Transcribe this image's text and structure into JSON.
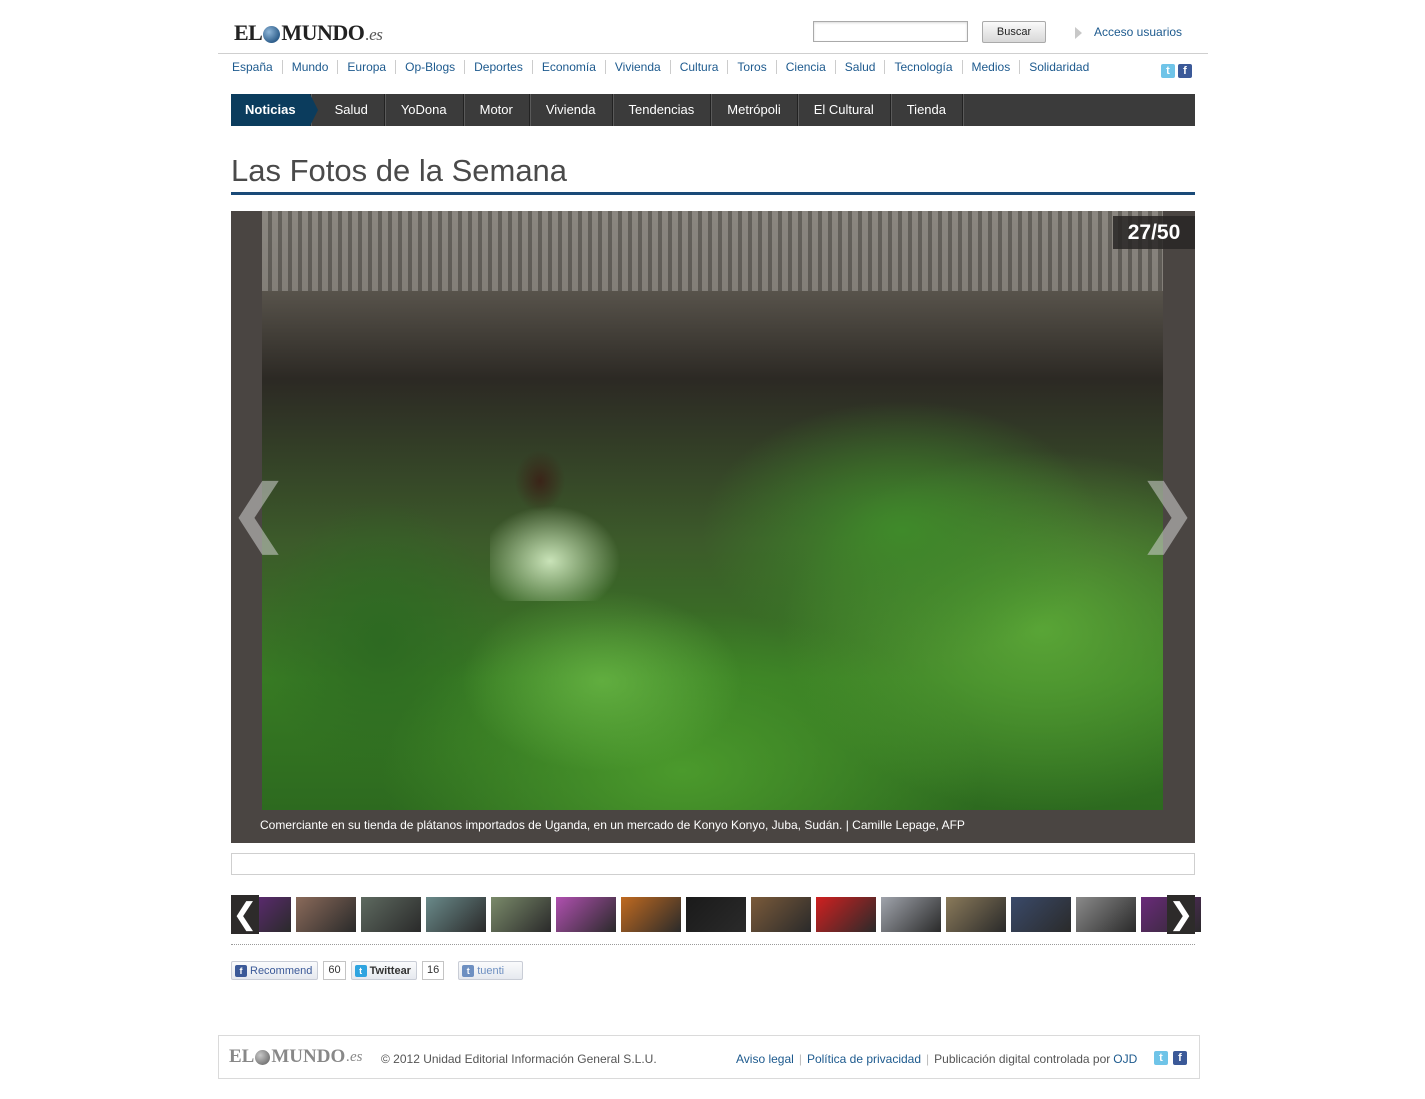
{
  "header": {
    "logo_main": "EL",
    "logo_rest": "MUNDO",
    "logo_suffix": ".es",
    "search_button": "Buscar",
    "access_link": "Acceso usuarios"
  },
  "sections": [
    "España",
    "Mundo",
    "Europa",
    "Op-Blogs",
    "Deportes",
    "Economía",
    "Vivienda",
    "Cultura",
    "Toros",
    "Ciencia",
    "Salud",
    "Tecnología",
    "Medios",
    "Solidaridad"
  ],
  "social": {
    "twitter_glyph": "t",
    "facebook_glyph": "f"
  },
  "mainnav": [
    "Noticias",
    "Salud",
    "YoDona",
    "Motor",
    "Vivienda",
    "Tendencias",
    "Metrópoli",
    "El Cultural",
    "Tienda"
  ],
  "page_title": "Las Fotos de la Semana",
  "gallery": {
    "counter": "27/50",
    "prev_glyph": "❮",
    "next_glyph": "❯",
    "caption": "Comerciante en su tienda de plátanos importados de Uganda, en un mercado de Konyo Konyo, Juba, Sudán. | Camille Lepage, AFP"
  },
  "thumbnails": {
    "prev_glyph": "❮",
    "next_glyph": "❯",
    "colors": [
      "#5a2a6e",
      "#8a6a5a",
      "#5e6a60",
      "#6a8a8a",
      "#7a8a6a",
      "#b050b0",
      "#c06a20",
      "#1a1a1a",
      "#7a5a3a",
      "#d02020",
      "#a0a4ac",
      "#8a7a5a",
      "#3a4a6a",
      "#8a8a8a",
      "#6a2a7a"
    ]
  },
  "share": {
    "recommend_label": "Recommend",
    "recommend_count": "60",
    "twitter_label": "Twittear",
    "twitter_count": "16",
    "tuenti_label": "tuenti",
    "fb_glyph": "f",
    "tw_glyph": "t",
    "tu_glyph": "t"
  },
  "footer": {
    "logo_main": "EL",
    "logo_rest": "MUNDO",
    "logo_suffix": ".es",
    "copyright": "© 2012 Unidad Editorial Información General S.L.U.",
    "aviso": "Aviso legal",
    "privacidad": "Política de privacidad",
    "publicacion": "Publicación digital controlada por ",
    "ojd": "OJD"
  },
  "colors": {
    "accent": "#1a4a78",
    "nav_bg": "#3b3b3b",
    "nav_active": "#0b3c5d",
    "link": "#1d5a8e",
    "gallery_bg": "#4a4542"
  }
}
